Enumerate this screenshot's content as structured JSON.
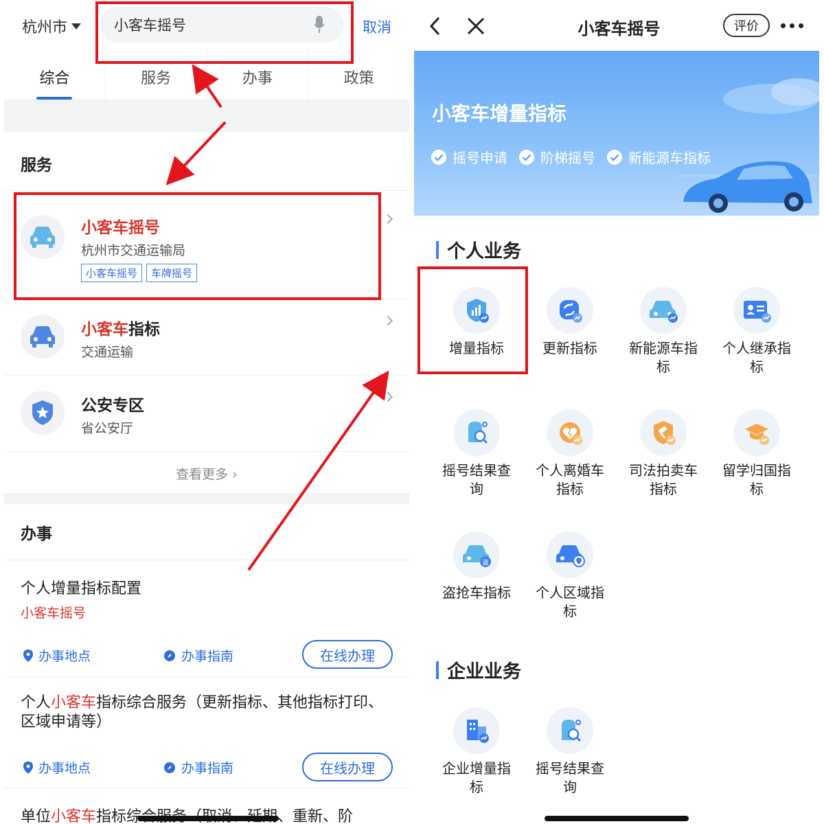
{
  "left": {
    "city": "杭州市",
    "search_value": "小客车摇号",
    "cancel": "取消",
    "tabs": [
      "综合",
      "服务",
      "办事",
      "政策"
    ],
    "services_title": "服务",
    "services": [
      {
        "title_hl": "小客车摇号",
        "title_rest": "",
        "sub": "杭州市交通运输局",
        "tags": [
          "小客车摇号",
          "车牌摇号"
        ]
      },
      {
        "title_hl": "小客车",
        "title_rest": "指标",
        "sub": "交通运输",
        "tags": []
      },
      {
        "title_hl": "",
        "title_rest": "公安专区",
        "sub": "省公安厅",
        "tags": []
      }
    ],
    "see_more": "查看更多",
    "affairs_title": "办事",
    "tasks": [
      {
        "pre": "个人增量指标配置",
        "hl": "",
        "post": "",
        "cat": "小客车摇号"
      },
      {
        "pre": "个人",
        "hl": "小客车",
        "post": "指标综合服务（更新指标、其他指标打印、区域申请等）",
        "cat": ""
      },
      {
        "pre": "单位",
        "hl": "小客车",
        "post": "指标综合服务（取消、延期、重新、阶",
        "cat": ""
      }
    ],
    "location_label": "办事地点",
    "guide_label": "办事指南",
    "online_label": "在线办理"
  },
  "right": {
    "title": "小客车摇号",
    "rate": "评价",
    "banner_title": "小客车增量指标",
    "banner_tags": [
      "摇号申请",
      "阶梯摇号",
      "新能源车指标"
    ],
    "personal_title": "个人业务",
    "personal_items": [
      {
        "line1": "增量指标",
        "line2": "",
        "icon": "shield-chart-icon"
      },
      {
        "line1": "更新指标",
        "line2": "",
        "icon": "refresh-icon"
      },
      {
        "line1": "新能源车指",
        "line2": "标",
        "icon": "ev-car-icon"
      },
      {
        "line1": "个人继承指",
        "line2": "标",
        "icon": "id-card-icon"
      },
      {
        "line1": "摇号结果查",
        "line2": "询",
        "icon": "search-doc-icon"
      },
      {
        "line1": "个人离婚车",
        "line2": "指标",
        "icon": "broken-heart-icon"
      },
      {
        "line1": "司法拍卖车",
        "line2": "指标",
        "icon": "gavel-icon"
      },
      {
        "line1": "留学归国指",
        "line2": "标",
        "icon": "graduation-cap-icon"
      },
      {
        "line1": "盗抢车指标",
        "line2": "",
        "icon": "stolen-car-icon"
      },
      {
        "line1": "个人区域指",
        "line2": "标",
        "icon": "car-location-icon"
      }
    ],
    "enterprise_title": "企业业务",
    "enterprise_items": [
      {
        "line1": "企业增量指",
        "line2": "标",
        "icon": "building-icon"
      },
      {
        "line1": "摇号结果查",
        "line2": "询",
        "icon": "search-doc-icon"
      }
    ]
  },
  "colors": {
    "accent": "#2b6ddf",
    "highlight": "#d9352b",
    "annotation": "#e3161e"
  }
}
